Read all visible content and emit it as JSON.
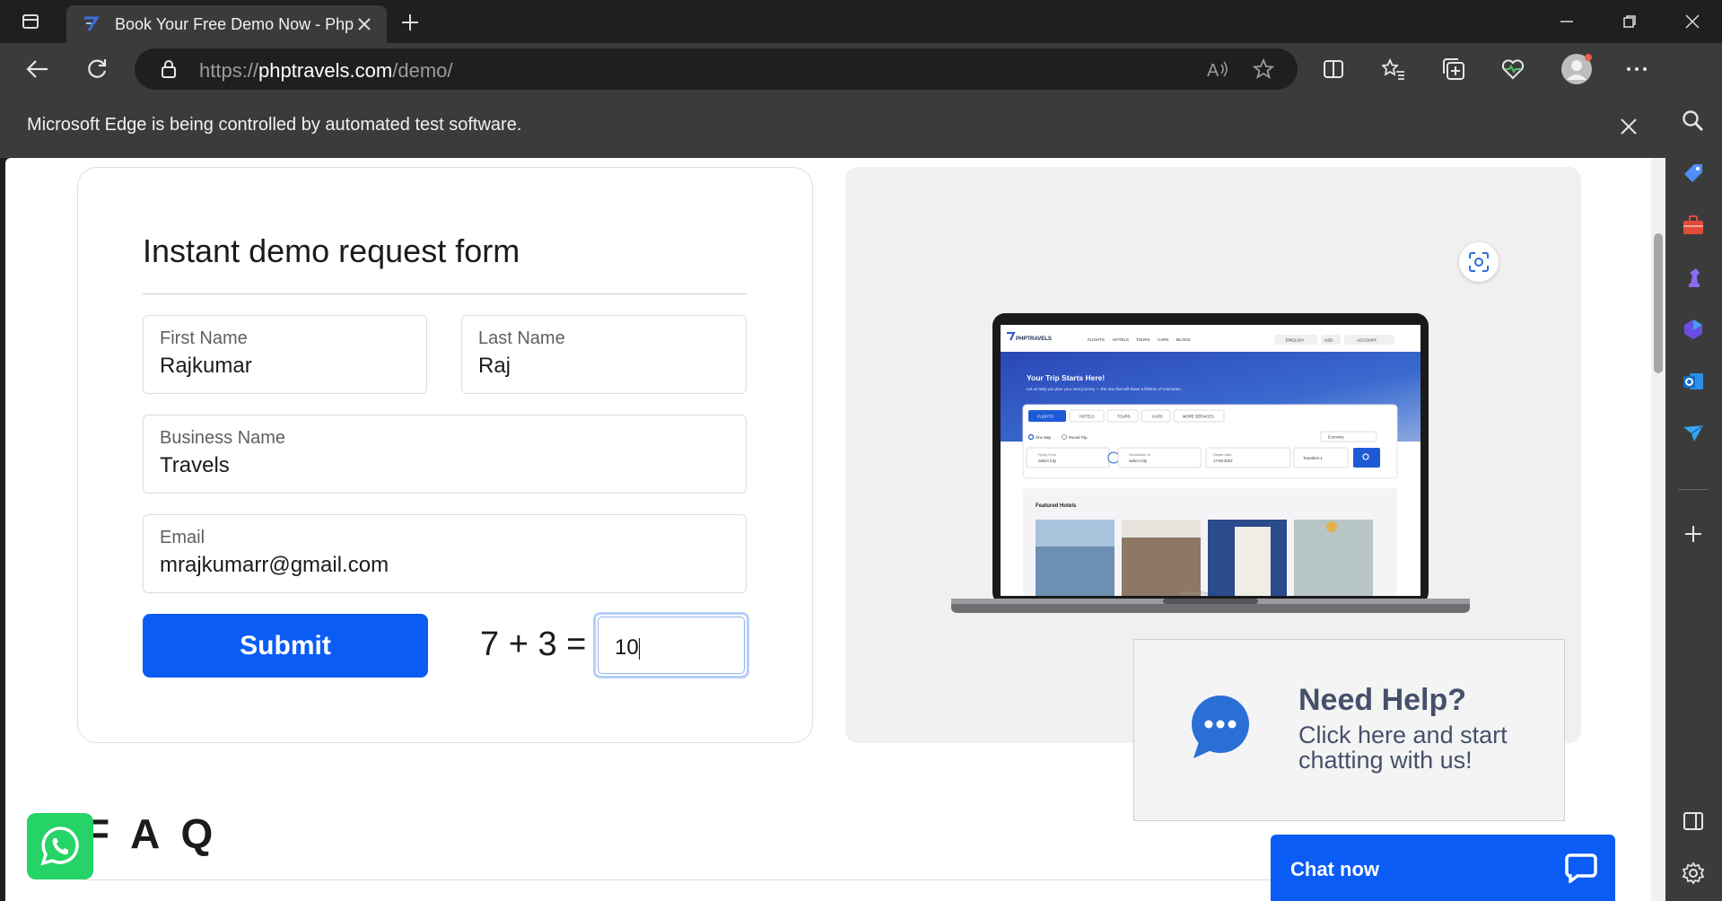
{
  "browser": {
    "tab_title": "Book Your Free Demo Now - Php",
    "url_prefix": "https://",
    "url_domain": "phptravels.com",
    "url_path": "/demo/",
    "infobar_message": "Microsoft Edge is being controlled by automated test software."
  },
  "form": {
    "title": "Instant demo request form",
    "first_name": {
      "label": "First Name",
      "value": "Rajkumar"
    },
    "last_name": {
      "label": "Last Name",
      "value": "Raj"
    },
    "business_name": {
      "label": "Business Name",
      "value": "Travels"
    },
    "email": {
      "label": "Email",
      "value": "mrajkumarr@gmail.com"
    },
    "submit_label": "Submit",
    "captcha_question": "7 + 3 =",
    "captcha_answer": "10"
  },
  "preview": {
    "brand": "PHPTRAVELS",
    "nav": [
      "FLIGHTS",
      "HOTELS",
      "TOURS",
      "CARS",
      "BLOGS"
    ],
    "lang": "ENGLISH",
    "currency": "USD",
    "account": "ACCOUNT",
    "hero_title": "Your Trip Starts Here!",
    "hero_sub": "Let us help you plan your next journey — the one that will leave a lifetime of memories.",
    "tabs": [
      "FLIGHTS",
      "HOTELS",
      "TOURS",
      "CARS",
      "MORE SERVICES"
    ],
    "one_way": "One Way",
    "round_trip": "Round Trip",
    "cabin": "Economy",
    "from_label": "Flying From",
    "from_value": "Select City",
    "to_label": "Destination To",
    "to_value": "Select City",
    "date_label": "Depart Date",
    "date_value": "17-08-2023",
    "travellers": "Travellers 1",
    "featured": "Featured Hotels",
    "device": "MacBook Pro"
  },
  "chat_widget": {
    "heading": "Need Help?",
    "subtext": "Click here and start chatting with us!",
    "button_label": "Chat now"
  },
  "faq_title": "F A Q",
  "colors": {
    "primary": "#0a5cf5",
    "whatsapp": "#25d366",
    "chat_text": "#45506a"
  }
}
